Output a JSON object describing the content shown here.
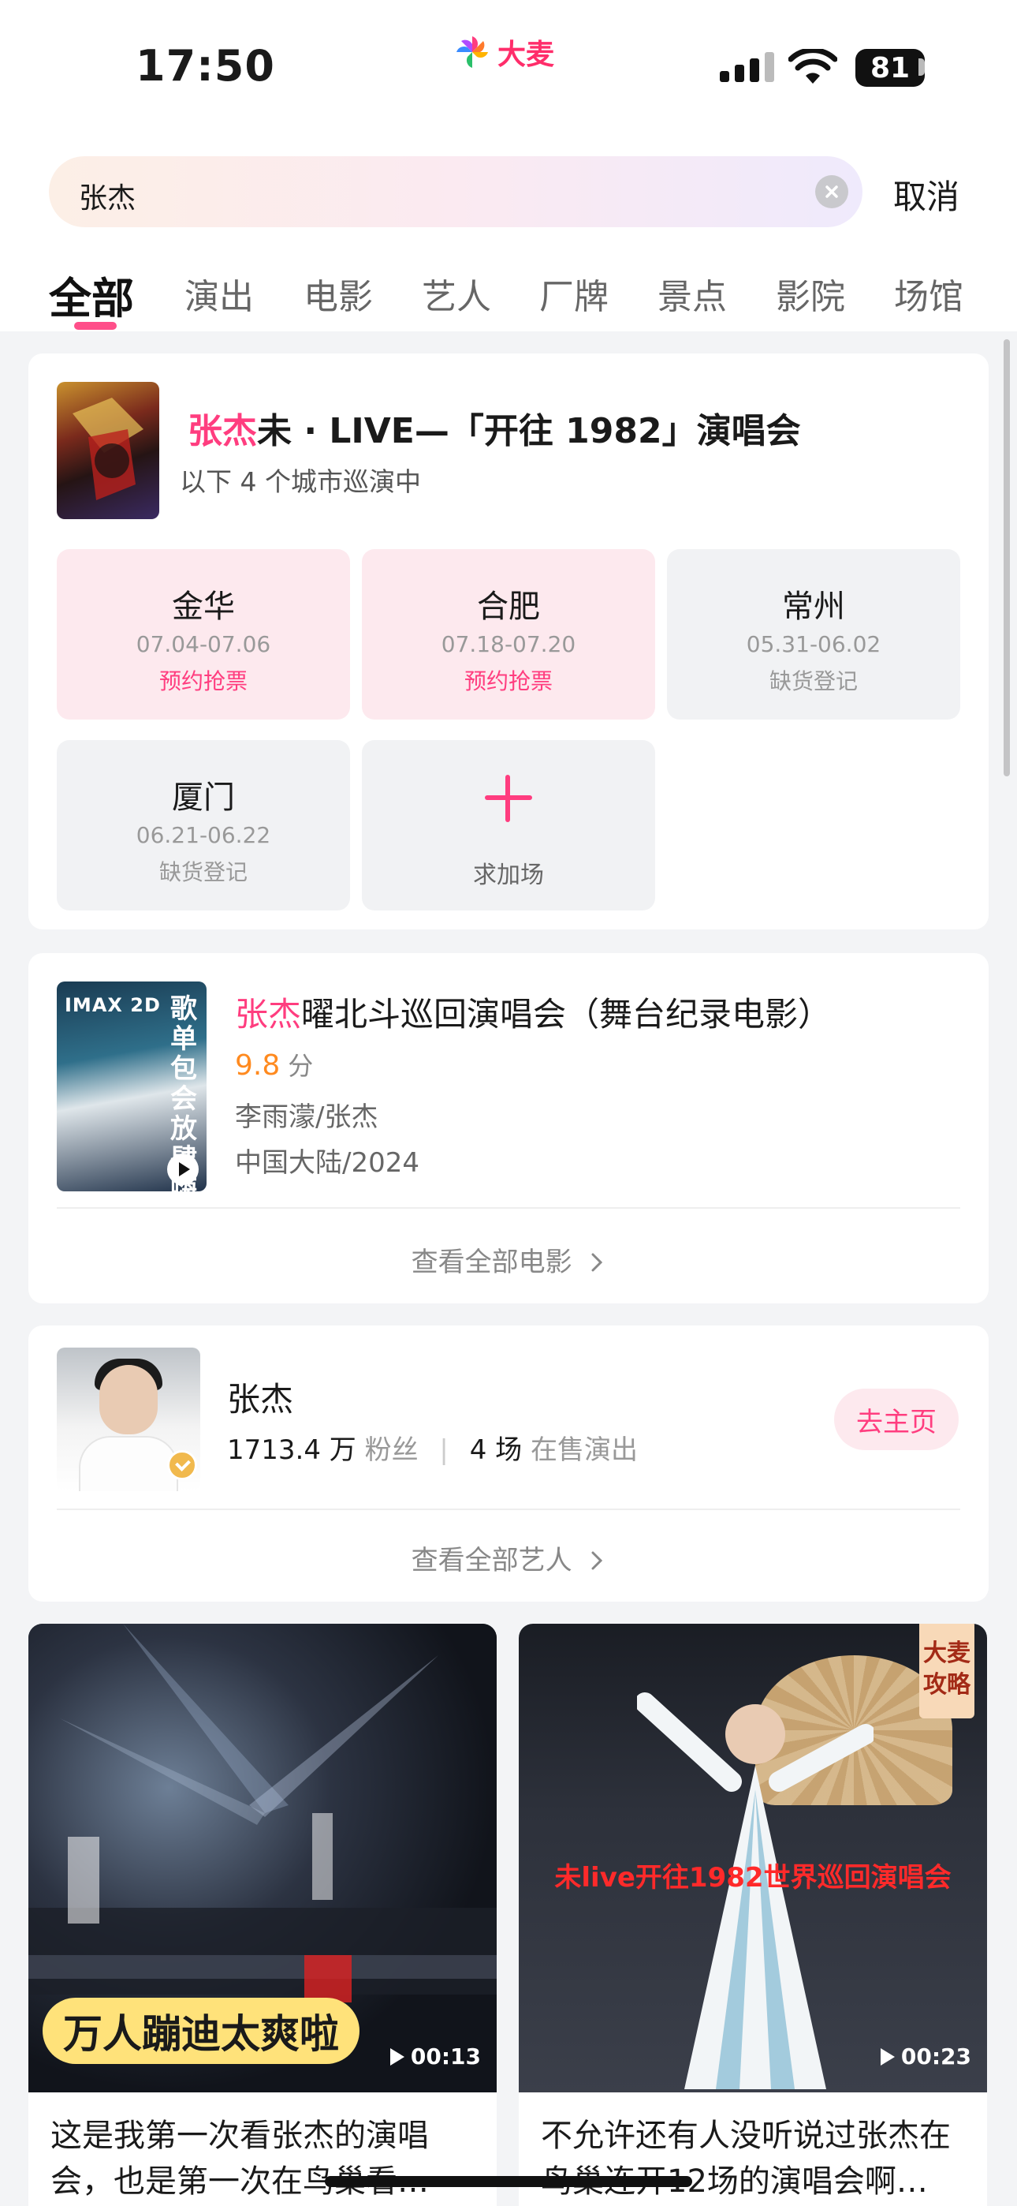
{
  "status_bar": {
    "time": "17:50",
    "brand": "大麦",
    "battery": "81"
  },
  "search": {
    "query": "张杰",
    "cancel_label": "取消"
  },
  "tabs": [
    {
      "label": "全部",
      "active": true
    },
    {
      "label": "演出"
    },
    {
      "label": "电影"
    },
    {
      "label": "艺人"
    },
    {
      "label": "厂牌"
    },
    {
      "label": "景点"
    },
    {
      "label": "影院"
    },
    {
      "label": "场馆"
    }
  ],
  "tour": {
    "title_highlight": "张杰",
    "title_rest": "未 · LIVE—「开往 1982」演唱会",
    "subtitle": "以下 4 个城市巡演中",
    "cities": [
      {
        "name": "金华",
        "date": "07.04-07.06",
        "status": "预约抢票",
        "style": "pink"
      },
      {
        "name": "合肥",
        "date": "07.18-07.20",
        "status": "预约抢票",
        "style": "pink"
      },
      {
        "name": "常州",
        "date": "05.31-06.02",
        "status": "缺货登记",
        "style": "gray"
      },
      {
        "name": "厦门",
        "date": "06.21-06.22",
        "status": "缺货登记",
        "style": "gray"
      }
    ],
    "add_show_label": "求加场"
  },
  "movie": {
    "poster_badge": "IMAX 2D",
    "poster_text": "歌单包会放肆嗨唱",
    "title_highlight": "张杰",
    "title_rest": "曜北斗巡回演唱会（舞台纪录电影）",
    "rating": "9.8",
    "rating_unit": "分",
    "cast": "李雨濛/张杰",
    "region_year": "中国大陆/2024",
    "view_all": "查看全部电影"
  },
  "artist": {
    "name": "张杰",
    "fans": "1713.4 万",
    "fans_label": "粉丝",
    "shows": "4 场",
    "shows_label": "在售演出",
    "home_button": "去主页",
    "view_all": "查看全部艺人"
  },
  "videos": [
    {
      "overlay": "万人蹦迪太爽啦",
      "duration": "00:13",
      "title": "这是我第一次看张杰的演唱会，也是第一次在鸟巢看…"
    },
    {
      "badge": "大麦攻略",
      "overlay": "未live开往1982世界巡回演唱会",
      "duration": "00:23",
      "title": "不允许还有人没听说过张杰在鸟巢连开12场的演唱会啊…"
    }
  ],
  "colors": {
    "accent": "#ff3d7f",
    "rating": "#ff8a1f",
    "background": "#f3f4f6"
  }
}
